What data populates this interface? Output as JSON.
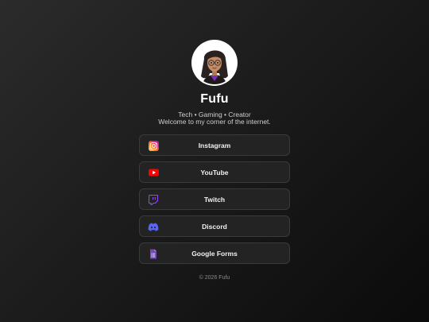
{
  "profile": {
    "name": "Fufu",
    "tagline": "Tech • Gaming • Creator",
    "welcome": "Welcome to my corner of the internet."
  },
  "links": [
    {
      "label": "Instagram",
      "icon": "instagram-icon",
      "color": "#e1306c"
    },
    {
      "label": "YouTube",
      "icon": "youtube-icon",
      "color": "#ff0000"
    },
    {
      "label": "Twitch",
      "icon": "twitch-icon",
      "color": "#9146ff"
    },
    {
      "label": "Discord",
      "icon": "discord-icon",
      "color": "#5865f2"
    },
    {
      "label": "Google Forms",
      "icon": "google-forms-icon",
      "color": "#7248b9"
    }
  ],
  "footer": {
    "text": "© 2026 Fufu"
  }
}
